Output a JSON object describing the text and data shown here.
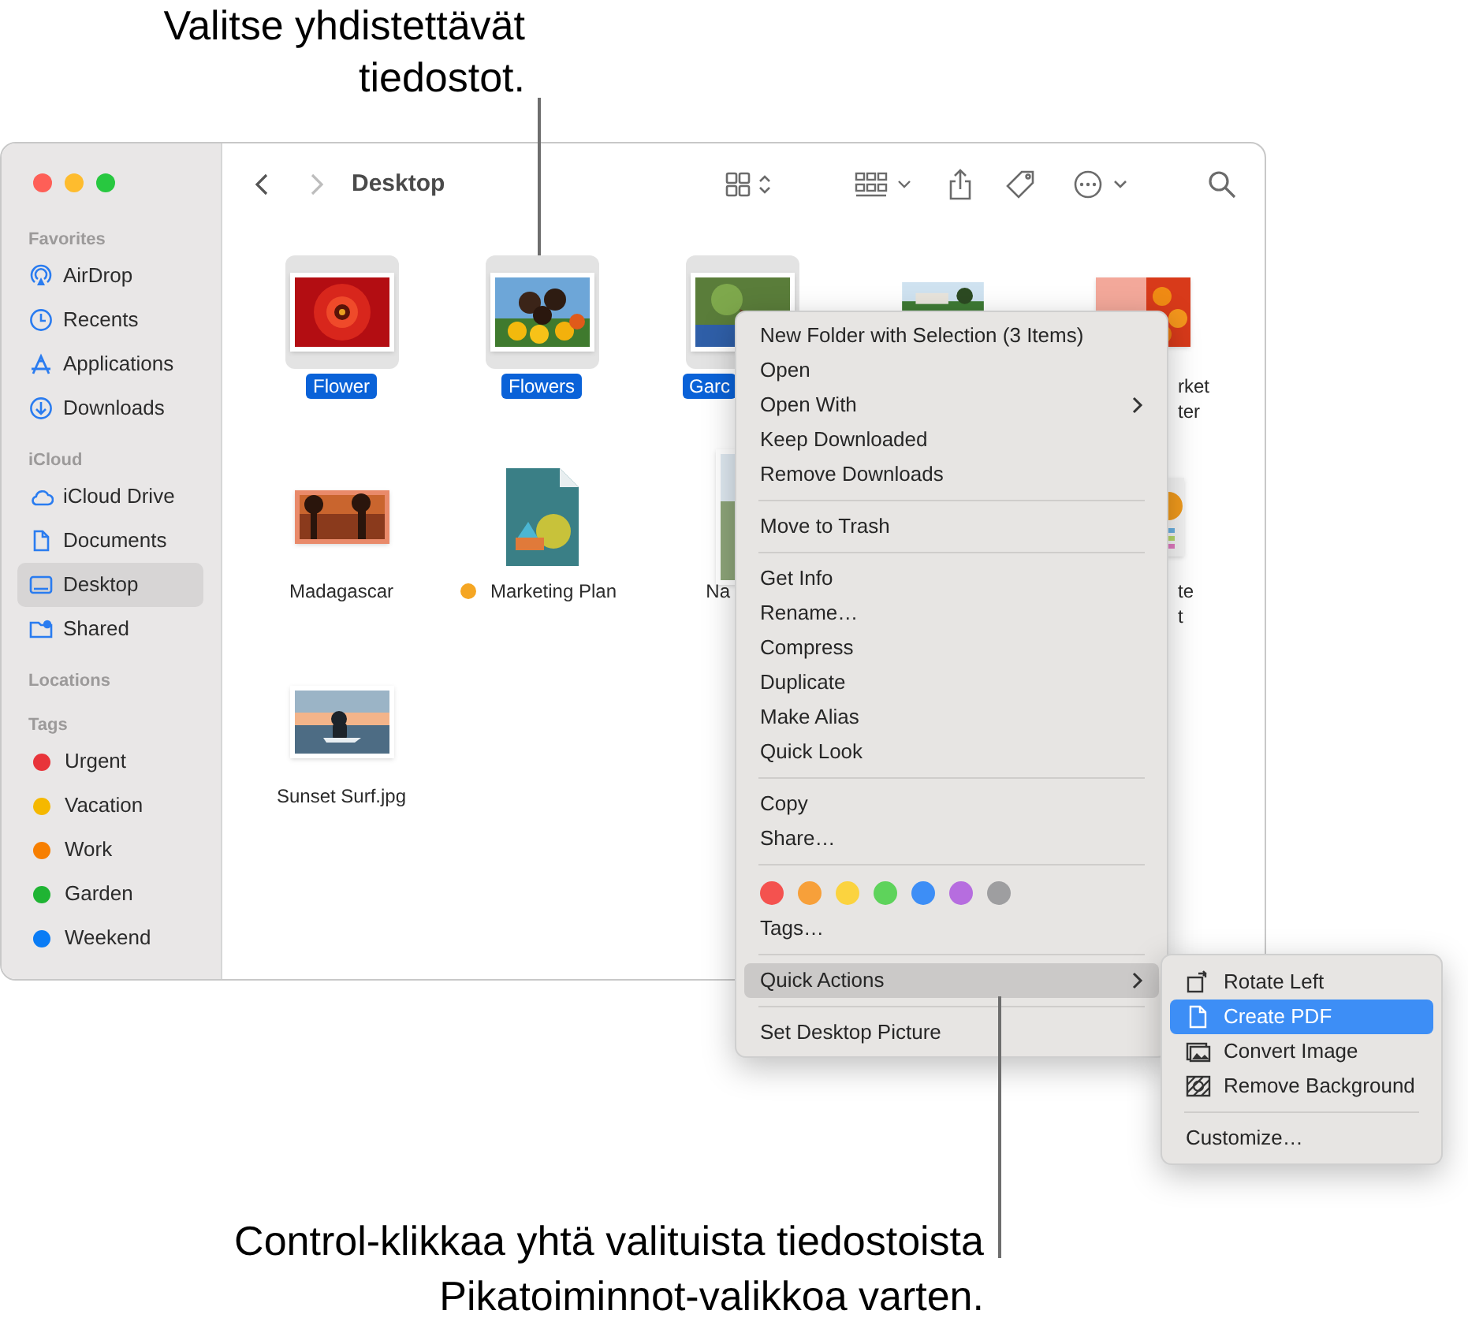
{
  "callouts": [
    {
      "lines": [
        "Valitse yhdistettävät",
        "tiedostot."
      ]
    },
    {
      "lines": [
        "Control-klikkaa yhtä valituista tiedostoista",
        "Pikatoiminnot-valikkoa varten."
      ]
    }
  ],
  "window": {
    "title": "Desktop"
  },
  "sidebar": {
    "sections": [
      {
        "title": "Favorites",
        "items": [
          {
            "label": "AirDrop",
            "selected": false
          },
          {
            "label": "Recents",
            "selected": false
          },
          {
            "label": "Applications",
            "selected": false
          },
          {
            "label": "Downloads",
            "selected": false
          }
        ]
      },
      {
        "title": "iCloud",
        "items": [
          {
            "label": "iCloud Drive",
            "selected": false
          },
          {
            "label": "Documents",
            "selected": false
          },
          {
            "label": "Desktop",
            "selected": true
          },
          {
            "label": "Shared",
            "selected": false
          }
        ]
      },
      {
        "title": "Locations"
      },
      {
        "title": "Tags",
        "items": [
          {
            "label": "Urgent",
            "color": "#e8343a",
            "selected": false
          },
          {
            "label": "Vacation",
            "color": "#f5b800",
            "selected": false
          },
          {
            "label": "Work",
            "color": "#f77f00",
            "selected": false
          },
          {
            "label": "Garden",
            "color": "#1fb433",
            "selected": false
          },
          {
            "label": "Weekend",
            "color": "#0a7cf5",
            "selected": false
          }
        ]
      }
    ]
  },
  "files": [
    {
      "kind": "full",
      "lines": [
        "Flower"
      ],
      "selected": true
    },
    {
      "kind": "full",
      "lines": [
        "Flowers"
      ],
      "selected": true
    },
    {
      "kind": "cut_right",
      "lines": [
        "Garc"
      ],
      "selected": true
    },
    {
      "kind": "hidden"
    },
    {
      "kind": "cut_left",
      "lines": [
        "rket",
        "ter"
      ],
      "selected": false
    },
    {
      "kind": "full",
      "lines": [
        "Madagascar"
      ],
      "selected": false
    },
    {
      "kind": "full",
      "lines": [
        "Marketing Plan"
      ],
      "selected": false,
      "color": "#f5a623"
    },
    {
      "kind": "cut_right",
      "lines": [
        "Na"
      ],
      "selected": false
    },
    {
      "kind": "empty"
    },
    {
      "kind": "cut_left",
      "lines": [
        "te",
        "t"
      ],
      "selected": false
    },
    {
      "kind": "full",
      "lines": [
        "Sunset Surf.jpg"
      ],
      "selected": false
    }
  ],
  "context_menu": {
    "items": [
      {
        "kind": "item",
        "label": "New Folder with Selection (3 Items)",
        "submenu": false,
        "selected": false
      },
      {
        "kind": "item",
        "label": "Open",
        "submenu": false,
        "selected": false
      },
      {
        "kind": "item",
        "label": "Open With",
        "submenu": true,
        "selected": false
      },
      {
        "kind": "item",
        "label": "Keep Downloaded",
        "submenu": false,
        "selected": false
      },
      {
        "kind": "item",
        "label": "Remove Downloads",
        "submenu": false,
        "selected": false
      },
      {
        "kind": "separator"
      },
      {
        "kind": "item",
        "label": "Move to Trash",
        "submenu": false,
        "selected": false
      },
      {
        "kind": "separator"
      },
      {
        "kind": "item",
        "label": "Get Info",
        "submenu": false,
        "selected": false
      },
      {
        "kind": "item",
        "label": "Rename…",
        "submenu": false,
        "selected": false
      },
      {
        "kind": "item",
        "label": "Compress",
        "submenu": false,
        "selected": false
      },
      {
        "kind": "item",
        "label": "Duplicate",
        "submenu": false,
        "selected": false
      },
      {
        "kind": "item",
        "label": "Make Alias",
        "submenu": false,
        "selected": false
      },
      {
        "kind": "item",
        "label": "Quick Look",
        "submenu": false,
        "selected": false
      },
      {
        "kind": "separator"
      },
      {
        "kind": "item",
        "label": "Copy",
        "submenu": false,
        "selected": false
      },
      {
        "kind": "item",
        "label": "Share…",
        "submenu": false,
        "selected": false
      },
      {
        "kind": "separator"
      },
      {
        "kind": "colors",
        "colors": [
          {
            "color": "#f4524f"
          },
          {
            "color": "#f7a03a"
          },
          {
            "color": "#fbd33f"
          },
          {
            "color": "#5ed35b"
          },
          {
            "color": "#3d8ef6"
          },
          {
            "color": "#b66ddf"
          },
          {
            "color": "#9e9ea0"
          }
        ]
      },
      {
        "kind": "item",
        "label": "Tags…",
        "submenu": false,
        "selected": false
      },
      {
        "kind": "separator"
      },
      {
        "kind": "item",
        "label": "Quick Actions",
        "submenu": true,
        "selected": true
      },
      {
        "kind": "separator"
      },
      {
        "kind": "item",
        "label": "Set Desktop Picture",
        "submenu": false,
        "selected": false
      }
    ]
  },
  "submenu": {
    "items": [
      {
        "kind": "item",
        "label": "Rotate Left",
        "selected": false
      },
      {
        "kind": "item",
        "label": "Create PDF",
        "selected": true
      },
      {
        "kind": "item",
        "label": "Convert Image",
        "selected": false
      },
      {
        "kind": "item",
        "label": "Remove Background",
        "selected": false
      },
      {
        "kind": "separator"
      },
      {
        "kind": "item",
        "label": "Customize…",
        "selected": false
      }
    ]
  }
}
